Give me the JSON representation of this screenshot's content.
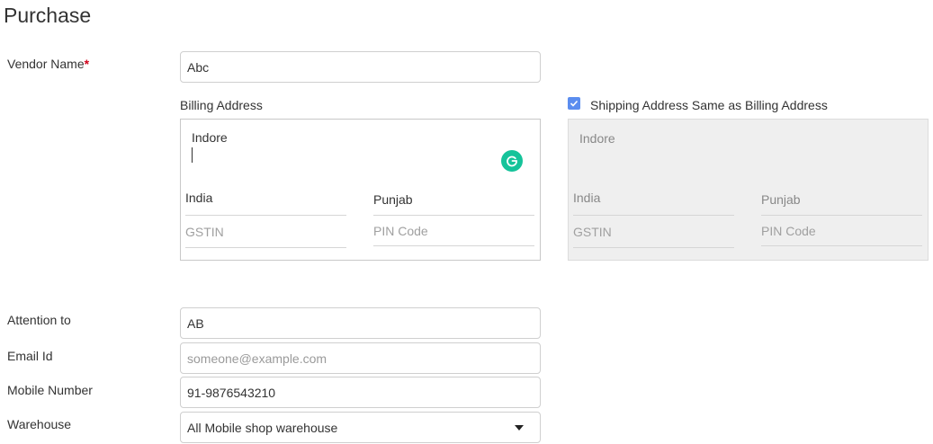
{
  "page": {
    "title": "Purchase"
  },
  "vendor": {
    "label": "Vendor Name",
    "required_mark": "*",
    "value": "Abc"
  },
  "billing": {
    "label": "Billing Address",
    "address": "Indore",
    "country": "India",
    "state": "Punjab",
    "gstin_placeholder": "GSTIN",
    "pin_placeholder": "PIN Code"
  },
  "shipping": {
    "same_as_billing_label": "Shipping Address Same as Billing Address",
    "same_as_billing_checked": true,
    "address": "Indore",
    "country": "India",
    "state": "Punjab",
    "gstin_placeholder": "GSTIN",
    "pin_placeholder": "PIN Code"
  },
  "attention": {
    "label": "Attention to",
    "value": "AB"
  },
  "email": {
    "label": "Email Id",
    "placeholder": "someone@example.com"
  },
  "mobile": {
    "label": "Mobile Number",
    "value": "91-9876543210"
  },
  "warehouse": {
    "label": "Warehouse",
    "selected": "All Mobile shop warehouse"
  },
  "icons": {
    "grammarly": "grammarly-icon",
    "checkbox": "checkmark-icon",
    "dropdown": "dropdown-arrow-icon"
  },
  "colors": {
    "grammarly": "#15c39a",
    "checkbox": "#5b8def",
    "required": "#d0021b",
    "disabled_bg": "#efefef"
  }
}
